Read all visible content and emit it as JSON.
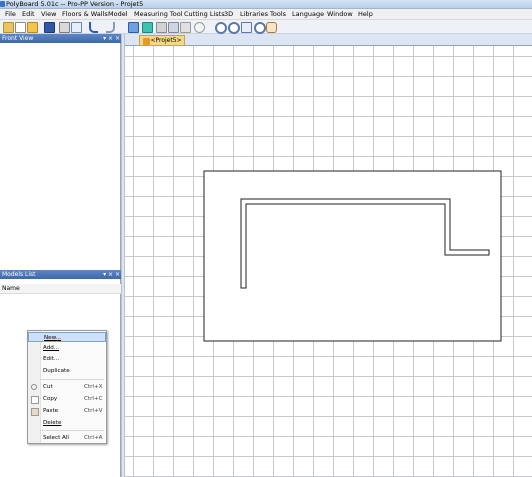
{
  "window": {
    "title": "PolyBoard 5.01c -- Pro-PP Version - Projet5"
  },
  "menu": [
    "File",
    "Edit",
    "View",
    "Floors & Walls",
    "Model",
    "Measuring Tool",
    "Cutting Lists",
    "3D",
    "Libraries",
    "Tools",
    "Language",
    "Window",
    "Help"
  ],
  "panels": {
    "front_view": {
      "title": "Front View",
      "buttons": "▾ ⨯ ×"
    },
    "models_list": {
      "title": "Models List",
      "buttons": "▾ ⨯ ×",
      "column_header": "Name"
    }
  },
  "document": {
    "tab_label": "<Projet5>"
  },
  "context_menu": {
    "items": [
      {
        "label": "New...",
        "shortcut": "",
        "highlighted": true,
        "icon": ""
      },
      {
        "label": "Add...",
        "shortcut": "",
        "highlighted": false,
        "icon": ""
      },
      {
        "label": "Edit...",
        "shortcut": "",
        "highlighted": false,
        "icon": ""
      },
      {
        "label": "Duplicate",
        "shortcut": "",
        "highlighted": false,
        "icon": ""
      },
      {
        "label": "Cut",
        "shortcut": "Ctrl+X",
        "highlighted": false,
        "icon": "scissors-icon"
      },
      {
        "label": "Copy",
        "shortcut": "Ctrl+C",
        "highlighted": false,
        "icon": "copy-icon"
      },
      {
        "label": "Paste",
        "shortcut": "Ctrl+V",
        "highlighted": false,
        "icon": "paste-icon"
      },
      {
        "label": "Delete",
        "shortcut": "",
        "highlighted": false,
        "icon": ""
      },
      {
        "label": "Select All",
        "shortcut": "Ctrl+A",
        "highlighted": false,
        "icon": ""
      }
    ]
  },
  "colors": {
    "grid": "#c6cad0",
    "panel_header": "#3c68ad",
    "highlight": "#cde0f7",
    "tab": "#f2d88a"
  }
}
